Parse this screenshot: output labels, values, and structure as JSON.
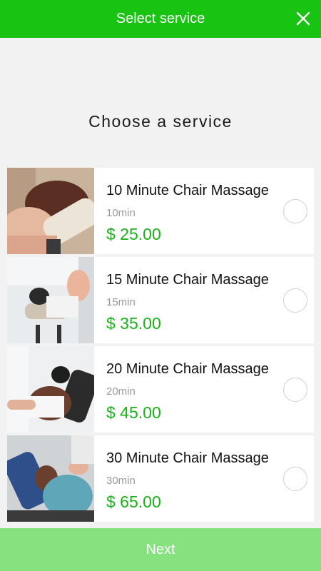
{
  "header": {
    "title": "Select service",
    "close_icon": "close-icon"
  },
  "main": {
    "heading": "Choose a service"
  },
  "services": [
    {
      "name": "10 Minute Chair Massage",
      "duration": "10min",
      "price": "$ 25.00",
      "selected": false
    },
    {
      "name": "15 Minute Chair Massage",
      "duration": "15min",
      "price": "$ 35.00",
      "selected": false
    },
    {
      "name": "20 Minute Chair Massage",
      "duration": "20min",
      "price": "$ 45.00",
      "selected": false
    },
    {
      "name": "30 Minute Chair Massage",
      "duration": "30min",
      "price": "$ 65.00",
      "selected": false
    }
  ],
  "footer": {
    "next_label": "Next"
  },
  "colors": {
    "brand": "#18c312",
    "price": "#18b316",
    "next_disabled": "#86e27e"
  }
}
